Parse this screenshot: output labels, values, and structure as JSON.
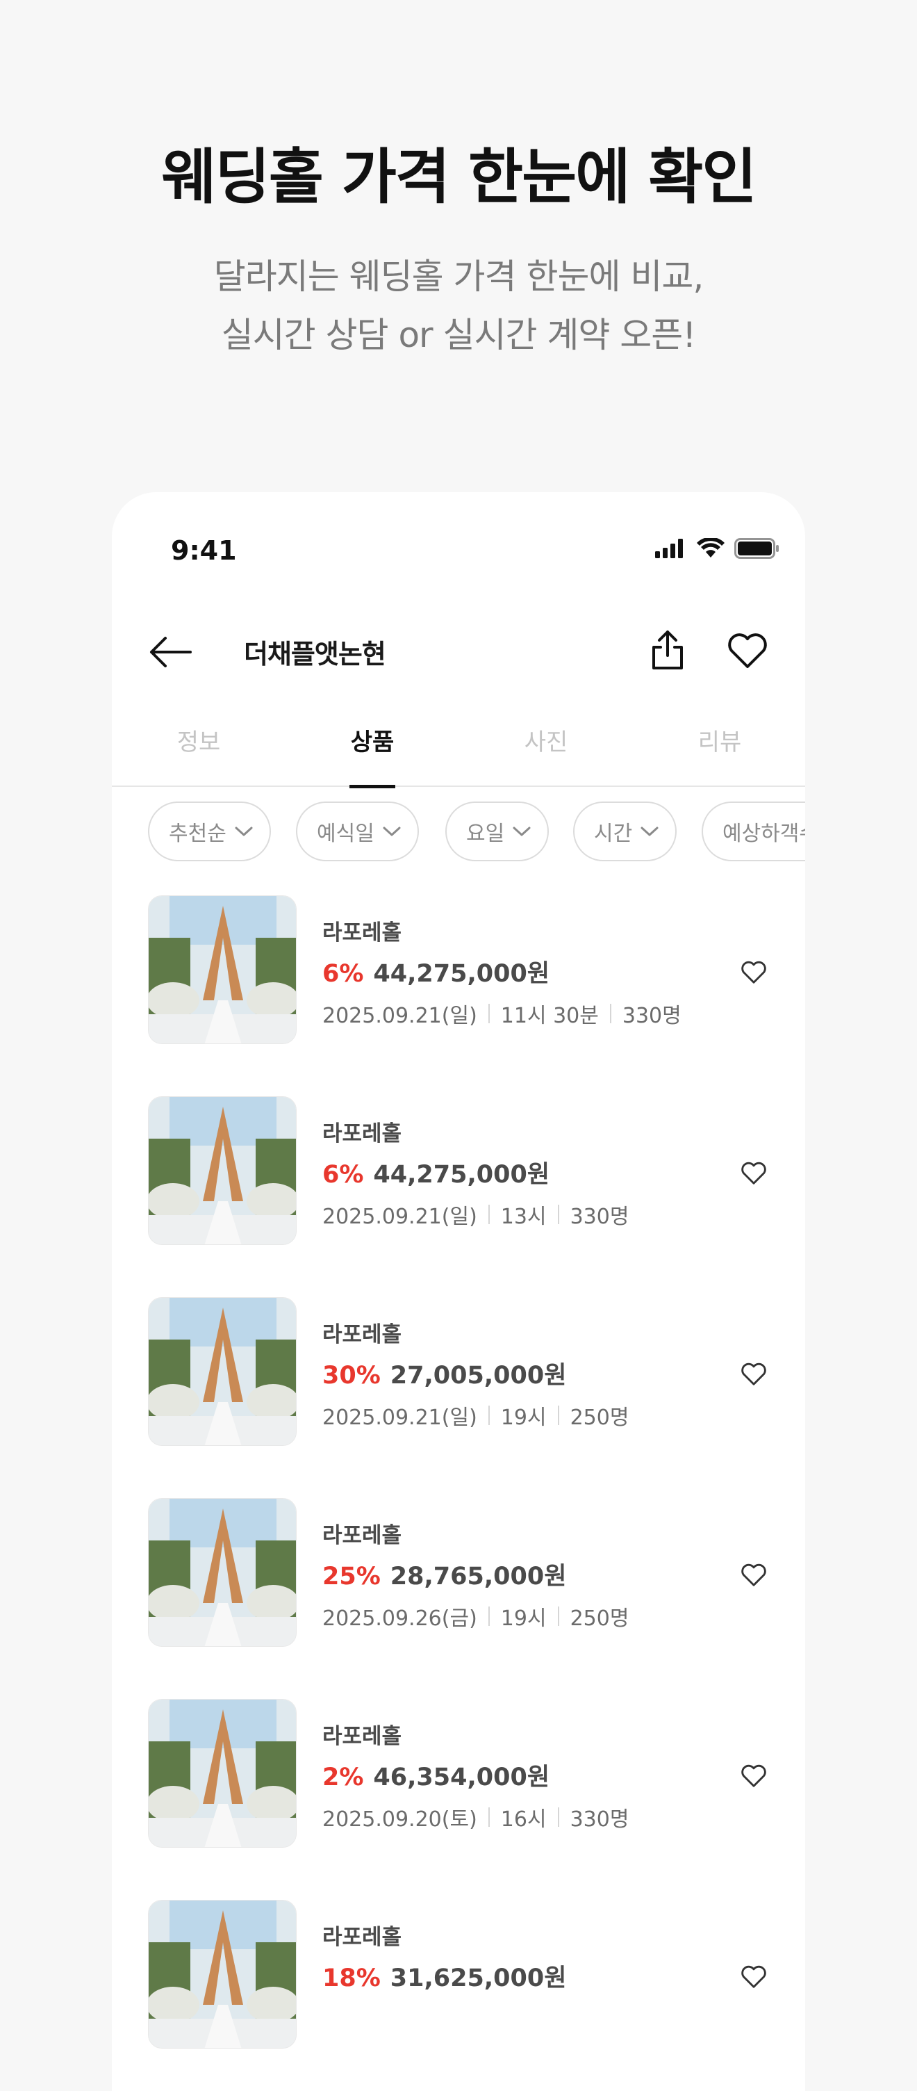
{
  "promo": {
    "title": "웨딩홀 가격 한눈에 확인",
    "subtitle_line1": "달라지는 웨딩홀 가격 한눈에 비교,",
    "subtitle_line2": "실시간 상담 or 실시간 계약 오픈!"
  },
  "status_bar": {
    "time": "9:41",
    "icons": [
      "signal-icon",
      "wifi-icon",
      "battery-icon"
    ]
  },
  "nav": {
    "title": "더채플앳논현",
    "back_icon": "arrow-left-icon",
    "share_icon": "share-icon",
    "favorite_icon": "heart-outline-icon"
  },
  "tabs": [
    {
      "label": "정보",
      "active": false
    },
    {
      "label": "상품",
      "active": true
    },
    {
      "label": "사진",
      "active": false
    },
    {
      "label": "리뷰",
      "active": false
    }
  ],
  "filters": [
    {
      "label": "추천순"
    },
    {
      "label": "예식일"
    },
    {
      "label": "요일"
    },
    {
      "label": "시간"
    },
    {
      "label": "예상하객수"
    }
  ],
  "products": [
    {
      "name": "라포레홀",
      "discount": "6%",
      "price": "44,275,000원",
      "date": "2025.09.21(일)",
      "time": "11시 30분",
      "guests": "330명"
    },
    {
      "name": "라포레홀",
      "discount": "6%",
      "price": "44,275,000원",
      "date": "2025.09.21(일)",
      "time": "13시",
      "guests": "330명"
    },
    {
      "name": "라포레홀",
      "discount": "30%",
      "price": "27,005,000원",
      "date": "2025.09.21(일)",
      "time": "19시",
      "guests": "250명"
    },
    {
      "name": "라포레홀",
      "discount": "25%",
      "price": "28,765,000원",
      "date": "2025.09.26(금)",
      "time": "19시",
      "guests": "250명"
    },
    {
      "name": "라포레홀",
      "discount": "2%",
      "price": "46,354,000원",
      "date": "2025.09.20(토)",
      "time": "16시",
      "guests": "330명"
    },
    {
      "name": "라포레홀",
      "discount": "18%",
      "price": "31,625,000원",
      "date": "",
      "time": "",
      "guests": ""
    }
  ],
  "colors": {
    "background": "#f7f7f7",
    "card": "#ffffff",
    "discount": "#e8372d",
    "text_primary": "#1a1a1a",
    "text_secondary": "#6b6b6b",
    "tab_inactive": "#c4c4c4"
  }
}
